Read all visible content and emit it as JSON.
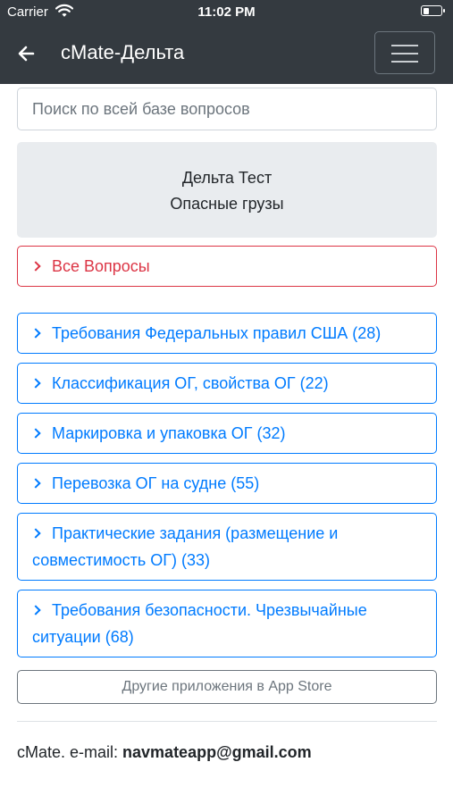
{
  "status_bar": {
    "carrier": "Carrier",
    "time": "11:02 PM"
  },
  "navbar": {
    "title": "cMate-Дельта"
  },
  "search": {
    "placeholder": "Поиск по всей базе вопросов"
  },
  "info_card": {
    "line1": "Дельта Тест",
    "line2": "Опасные грузы"
  },
  "all_questions": {
    "label": "Все Вопросы",
    "color": "#dc3545"
  },
  "categories": [
    {
      "label": "Требования Федеральных правил США (28)"
    },
    {
      "label": "Классификация ОГ, свойства ОГ (22)"
    },
    {
      "label": "Маркировка и упаковка ОГ (32)"
    },
    {
      "label": "Перевозка ОГ на судне (55)"
    },
    {
      "label": "Практические задания (размещение и совместимость ОГ) (33)"
    },
    {
      "label": "Требования безопасности. Чрезвычайные ситуации (68)"
    }
  ],
  "accent_color": "#007bff",
  "other_apps": {
    "label": "Другие приложения в App Store"
  },
  "footer": {
    "prefix": "cMate. e-mail: ",
    "email": "navmateapp@gmail.com"
  }
}
